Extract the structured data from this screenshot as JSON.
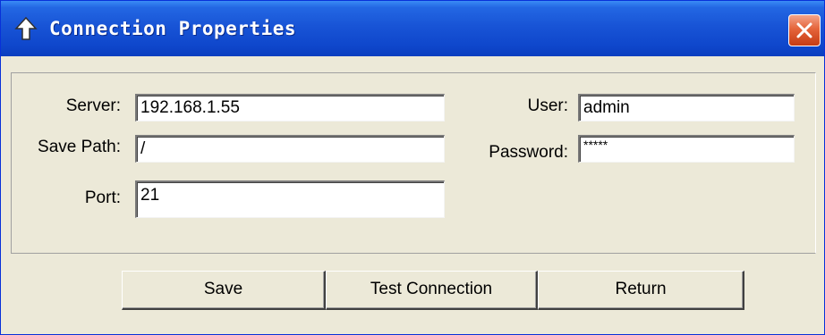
{
  "window": {
    "title": "Connection Properties",
    "title_icon": "up-arrow-icon",
    "close_icon": "close-icon"
  },
  "form": {
    "server": {
      "label": "Server:",
      "value": "192.168.1.55"
    },
    "save_path": {
      "label": "Save Path:",
      "value": "/"
    },
    "port": {
      "label": "Port:",
      "value": "21"
    },
    "user": {
      "label": "User:",
      "value": "admin"
    },
    "password": {
      "label": "Password:",
      "value": "*****"
    }
  },
  "buttons": {
    "save": "Save",
    "test_connection": "Test Connection",
    "return": "Return"
  },
  "colors": {
    "titlebar": "#1854d6",
    "window_bg": "#ece9d8",
    "close_button": "#e5643a"
  }
}
